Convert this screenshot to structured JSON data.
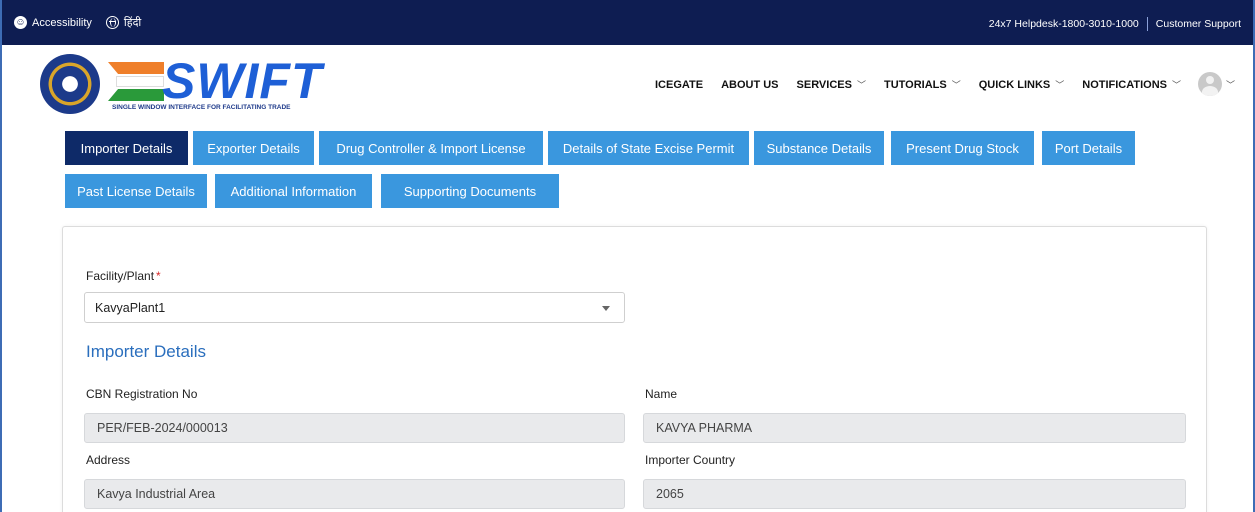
{
  "topbar": {
    "accessibility_label": "Accessibility",
    "language_label": "हिंदी",
    "helpdesk": "24x7 Helpdesk-1800-3010-1000",
    "support": "Customer Support"
  },
  "header": {
    "logo_word": "SWIFT",
    "logo_tagline": "SINGLE WINDOW INTERFACE FOR FACILITATING TRADE",
    "nav": [
      {
        "label": "ICEGATE"
      },
      {
        "label": "ABOUT US"
      },
      {
        "label": "SERVICES"
      },
      {
        "label": "TUTORIALS"
      },
      {
        "label": "QUICK LINKS"
      },
      {
        "label": "NOTIFICATIONS"
      }
    ]
  },
  "tabs": [
    {
      "label": "Importer Details"
    },
    {
      "label": "Exporter Details"
    },
    {
      "label": "Drug Controller & Import License"
    },
    {
      "label": "Details of State Excise Permit"
    },
    {
      "label": "Substance Details"
    },
    {
      "label": "Present Drug Stock"
    },
    {
      "label": "Port Details"
    },
    {
      "label": "Past License Details"
    },
    {
      "label": "Additional Information"
    },
    {
      "label": "Supporting Documents"
    }
  ],
  "form": {
    "facility_label": "Facility/Plant",
    "facility_required": "*",
    "facility_value": "KavyaPlant1",
    "section_title": "Importer Details",
    "cbn_label": "CBN Registration No",
    "cbn_value": "PER/FEB-2024/000013",
    "name_label": "Name",
    "name_value": "KAVYA PHARMA",
    "address_label": "Address",
    "address_value": "Kavya Industrial Area",
    "country_label": "Importer Country",
    "country_value": "2065"
  },
  "colors": {
    "topbar_bg": "#0e1d52",
    "tab_bg": "#3a97de",
    "tab_active_bg": "#0e2a68",
    "section_title": "#2a6ebd"
  }
}
